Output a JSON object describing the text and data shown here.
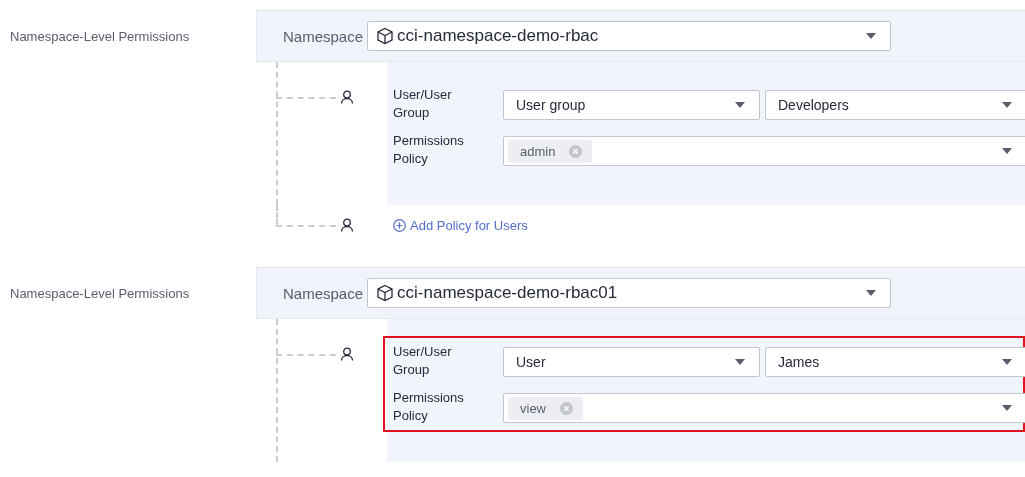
{
  "sections": [
    {
      "label": "Namespace-Level Permissions",
      "namespace_label": "Namespace",
      "namespace": "cci-namespace-demo-rbac",
      "policies": [
        {
          "user_label": "User/User Group",
          "user_type": "User group",
          "user_name": "Developers",
          "policy_label": "Permissions Policy",
          "tags": [
            "admin"
          ],
          "highlighted": false
        }
      ],
      "add_link": "Add Policy for Users"
    },
    {
      "label": "Namespace-Level Permissions",
      "namespace_label": "Namespace",
      "namespace": "cci-namespace-demo-rbac01",
      "policies": [
        {
          "user_label": "User/User Group",
          "user_type": "User",
          "user_name": "James",
          "policy_label": "Permissions Policy",
          "tags": [
            "view"
          ],
          "highlighted": true
        }
      ]
    }
  ]
}
